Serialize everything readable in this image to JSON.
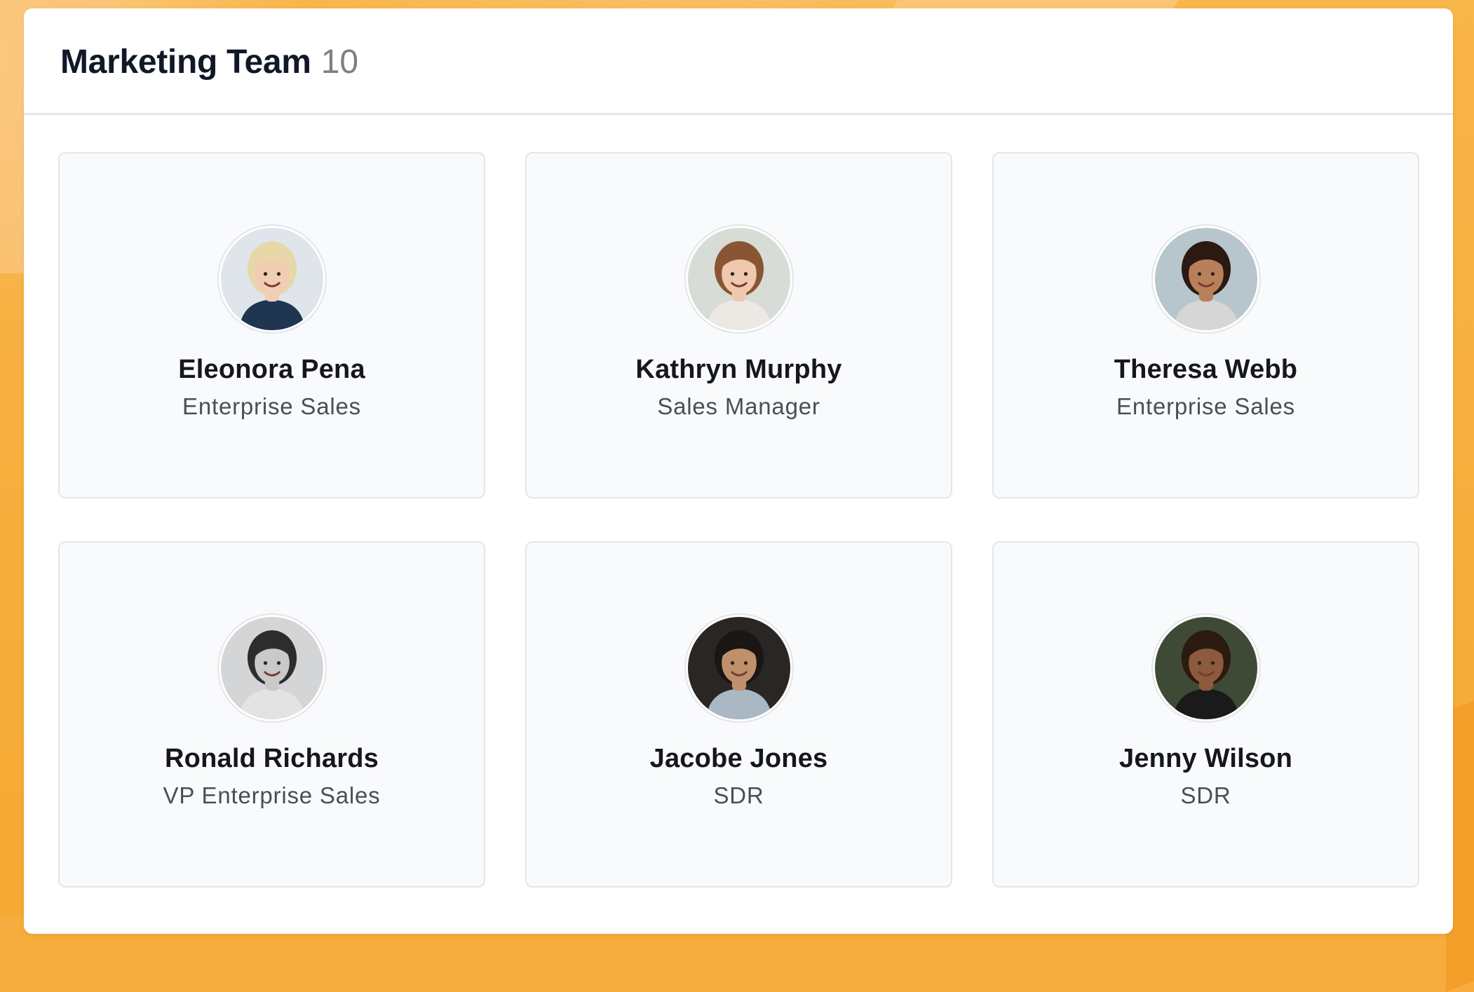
{
  "team": {
    "title": "Marketing Team",
    "count": "10"
  },
  "members": [
    {
      "name": "Eleonora Pena",
      "role": "Enterprise Sales",
      "avatar": {
        "bg": "#dfe5ea",
        "skin": "#f1cdb3",
        "hair": "#e8d7a8",
        "shirt": "#1f3552"
      }
    },
    {
      "name": "Kathryn Murphy",
      "role": "Sales Manager",
      "avatar": {
        "bg": "#d8dcd6",
        "skin": "#efc8ae",
        "hair": "#8a5533",
        "shirt": "#ece9e4"
      }
    },
    {
      "name": "Theresa Webb",
      "role": "Enterprise Sales",
      "avatar": {
        "bg": "#b7c6cc",
        "skin": "#b8805a",
        "hair": "#2a1a12",
        "shirt": "#d6d6d6"
      }
    },
    {
      "name": "Ronald Richards",
      "role": "VP Enterprise Sales",
      "avatar": {
        "bg": "#d4d5d7",
        "skin": "#c9c9c9",
        "hair": "#2d2d2d",
        "shirt": "#e3e3e3"
      }
    },
    {
      "name": "Jacobe Jones",
      "role": "SDR",
      "avatar": {
        "bg": "#2a2624",
        "skin": "#c0906c",
        "hair": "#1b1513",
        "shirt": "#aab8c4"
      }
    },
    {
      "name": "Jenny Wilson",
      "role": "SDR",
      "avatar": {
        "bg": "#3e4a35",
        "skin": "#8c5a3c",
        "hair": "#2b1a10",
        "shirt": "#1a1a1a"
      }
    }
  ]
}
